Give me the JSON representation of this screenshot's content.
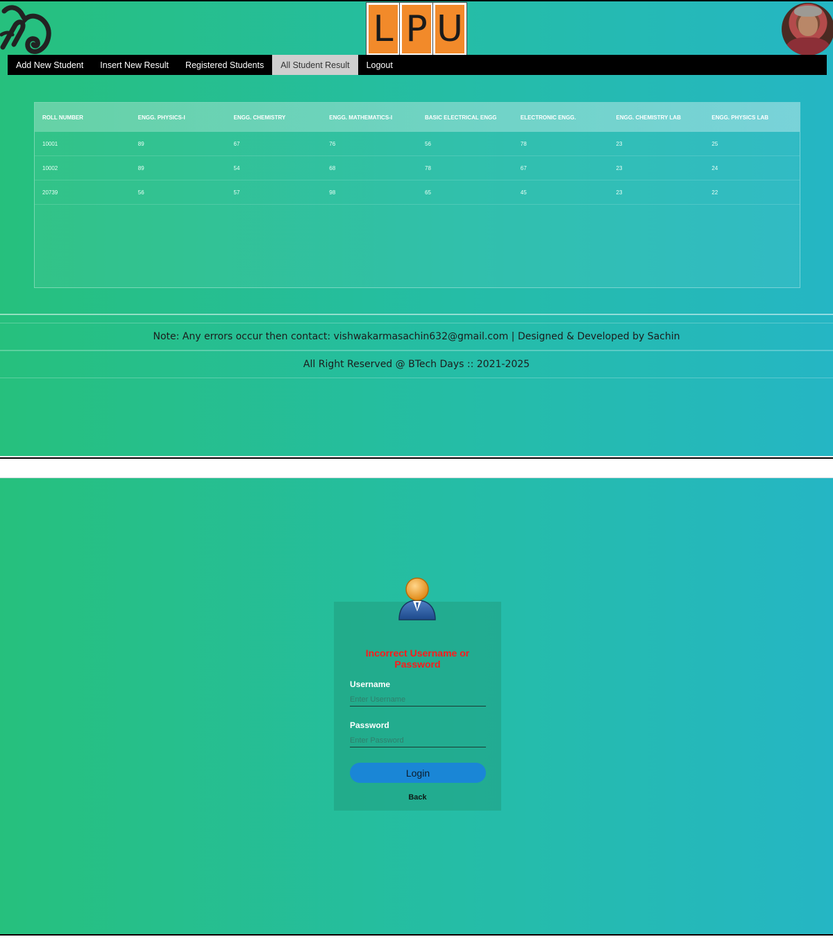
{
  "header": {
    "left_logo_icon": "swirl-logo-icon",
    "center_logo_letters": [
      "L",
      "P",
      "U"
    ],
    "avatar_icon": "profile-photo"
  },
  "nav": {
    "items": [
      {
        "label": "Add New Student",
        "active": false
      },
      {
        "label": "Insert New Result",
        "active": false
      },
      {
        "label": "Registered Students",
        "active": false
      },
      {
        "label": "All Student Result",
        "active": true
      },
      {
        "label": "Logout",
        "active": false
      }
    ]
  },
  "results_table": {
    "columns": [
      "ROLL NUMBER",
      "ENGG. PHYSICS-I",
      "ENGG. CHEMISTRY",
      "ENGG. MATHEMATICS-I",
      "BASIC ELECTRICAL ENGG",
      "ELECTRONIC ENGG.",
      "ENGG. CHEMISTRY LAB",
      "ENGG. PHYSICS LAB"
    ],
    "rows": [
      [
        "10001",
        "89",
        "67",
        "76",
        "56",
        "78",
        "23",
        "25"
      ],
      [
        "10002",
        "89",
        "54",
        "68",
        "78",
        "67",
        "23",
        "24"
      ],
      [
        "20739",
        "56",
        "57",
        "98",
        "65",
        "45",
        "23",
        "22"
      ]
    ]
  },
  "footer": {
    "note": "Note: Any errors occur then contact: vishwakarmasachin632@gmail.com | Designed & Developed by Sachin",
    "rights": "All Right Reserved @ BTech Days :: 2021-2025"
  },
  "login": {
    "user_icon": "user-avatar-icon",
    "error": "Incorrect Username or Password",
    "username_label": "Username",
    "username_placeholder": "Enter Username",
    "password_label": "Password",
    "password_placeholder": "Enter Password",
    "login_button": "Login",
    "back_link": "Back"
  },
  "colors": {
    "gradient_start": "#26c07d",
    "gradient_end": "#25b6c4",
    "lpu_orange": "#f28a2a",
    "error_red": "#ff1a1a",
    "button_blue": "#1a86d6"
  }
}
